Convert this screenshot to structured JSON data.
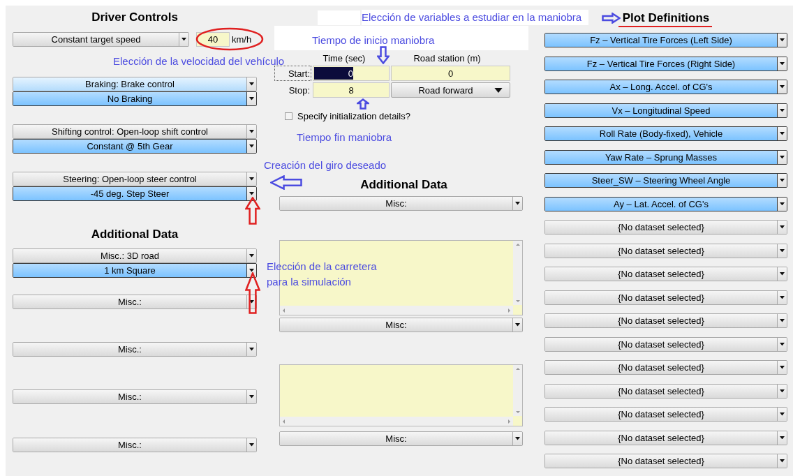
{
  "left": {
    "title": "Driver Controls",
    "speed": {
      "mode": "Constant target speed",
      "value": "40",
      "unit": "km/h"
    },
    "groups": [
      {
        "header": "Braking: Brake control",
        "focused": true,
        "value": "No Braking"
      },
      {
        "header": "Shifting control: Open-loop shift control",
        "focused": false,
        "value": "Constant @ 5th Gear"
      },
      {
        "header": "Steering: Open-loop steer control",
        "focused": false,
        "value": "-45 deg. Step Steer"
      }
    ],
    "additional_title": "Additional Data",
    "additional": [
      {
        "kind": "pair",
        "header": "Misc.: 3D road",
        "value": "1 km Square"
      },
      {
        "kind": "single",
        "header": "Misc.:"
      },
      {
        "kind": "single",
        "header": "Misc.:"
      },
      {
        "kind": "single",
        "header": "Misc.:"
      },
      {
        "kind": "single",
        "header": "Misc.:"
      }
    ]
  },
  "middle": {
    "time_header": "Time (sec)",
    "station_header": "Road station (m)",
    "start": {
      "label": "Start:",
      "focused": true,
      "time": "0",
      "time_selected": true,
      "station": "0"
    },
    "stop": {
      "label": "Stop:",
      "time": "8",
      "station_mode": "Road forward"
    },
    "init_checkbox": {
      "label": "Specify initialization details?",
      "checked": false
    },
    "additional_title": "Additional Data",
    "blocks": [
      {
        "kind": "dropdown",
        "label": "Misc:"
      },
      {
        "kind": "textarea"
      },
      {
        "kind": "dropdown",
        "label": "Misc:"
      },
      {
        "kind": "textarea"
      },
      {
        "kind": "dropdown",
        "label": "Misc:"
      }
    ]
  },
  "right": {
    "title": "Plot Definitions",
    "plots": [
      {
        "label": "Fz – Vertical Tire Forces (Left Side)",
        "linked": true
      },
      {
        "label": "Fz – Vertical Tire Forces (Right Side)",
        "linked": true
      },
      {
        "label": "Ax – Long. Accel. of CG's",
        "linked": true
      },
      {
        "label": "Vx – Longitudinal Speed",
        "linked": true
      },
      {
        "label": "Roll Rate (Body-fixed), Vehicle",
        "linked": true
      },
      {
        "label": "Yaw Rate – Sprung Masses",
        "linked": true
      },
      {
        "label": "Steer_SW – Steering Wheel Angle",
        "linked": true
      },
      {
        "label": "Ay – Lat. Accel. of CG's",
        "linked": true
      },
      {
        "label": "{No dataset selected}",
        "linked": false
      },
      {
        "label": "{No dataset selected}",
        "linked": false
      },
      {
        "label": "{No dataset selected}",
        "linked": false
      },
      {
        "label": "{No dataset selected}",
        "linked": false
      },
      {
        "label": "{No dataset selected}",
        "linked": false
      },
      {
        "label": "{No dataset selected}",
        "linked": false
      },
      {
        "label": "{No dataset selected}",
        "linked": false
      },
      {
        "label": "{No dataset selected}",
        "linked": false
      },
      {
        "label": "{No dataset selected}",
        "linked": false
      },
      {
        "label": "{No dataset selected}",
        "linked": false
      },
      {
        "label": "{No dataset selected}",
        "linked": false
      }
    ]
  },
  "annotations": [
    {
      "text": "Elección de variables a estudiar en la maniobra"
    },
    {
      "text": "Tiempo de inicio maniobra"
    },
    {
      "text": "Elección de la velocidad del vehículo"
    },
    {
      "text": "Tiempo fin maniobra"
    },
    {
      "text": "Creación del giro deseado"
    },
    {
      "text": "Elección de la carretera para la simulación"
    }
  ]
}
